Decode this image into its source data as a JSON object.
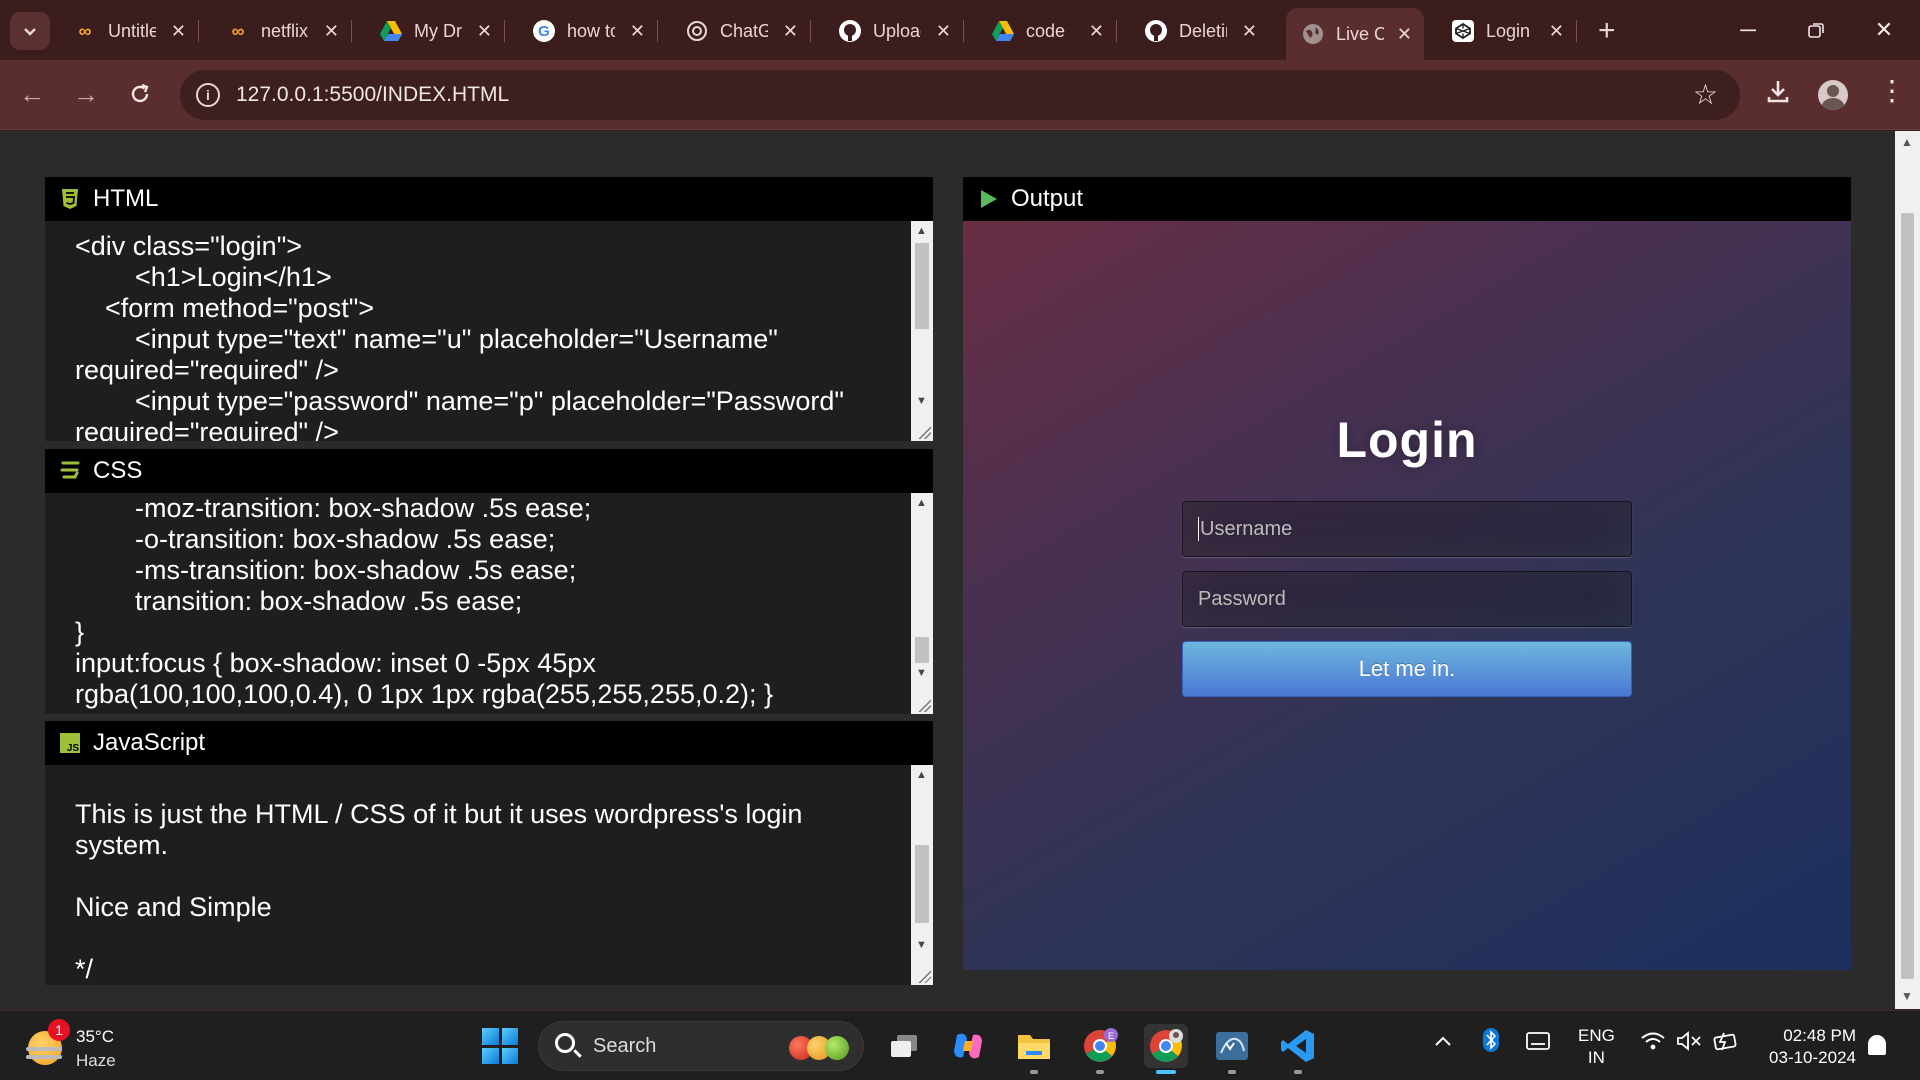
{
  "browser": {
    "tabs": [
      {
        "icon": "codepen-infinity-icon",
        "title": "Untitled",
        "active": false
      },
      {
        "icon": "codepen-infinity-icon",
        "title": "netflix",
        "active": false
      },
      {
        "icon": "google-drive-icon",
        "title": "My Drive",
        "active": false
      },
      {
        "icon": "google-icon",
        "title": "how to",
        "active": false
      },
      {
        "icon": "chatgpt-icon",
        "title": "ChatGPT",
        "active": false
      },
      {
        "icon": "github-icon",
        "title": "Upload",
        "active": false
      },
      {
        "icon": "google-drive-icon",
        "title": "code",
        "active": false
      },
      {
        "icon": "github-icon",
        "title": "Deleting",
        "active": false
      },
      {
        "icon": "globe-icon",
        "title": "Live Code",
        "active": true
      },
      {
        "icon": "codepen-box-icon",
        "title": "Login",
        "active": false
      }
    ],
    "url": "127.0.0.1:5500/INDEX.HTML"
  },
  "panels": {
    "html": {
      "title": "HTML",
      "code": "<div class=\"login\">\n        <h1>Login</h1>\n    <form method=\"post\">\n        <input type=\"text\" name=\"u\" placeholder=\"Username\"\nrequired=\"required\" />\n        <input type=\"password\" name=\"p\" placeholder=\"Password\"\nrequired=\"required\" />"
    },
    "css": {
      "title": "CSS",
      "lines": [
        {
          "text": "        -moz-transition: box-shadow .5s ease;"
        },
        {
          "text": "        -o-transition: box-shadow .5s ease;"
        },
        {
          "text": "        -ms-transition: box-shadow .5s ease;"
        },
        {
          "text": "        transition: box-shadow .5s ease;"
        },
        {
          "text": "}"
        },
        {
          "text": "input:focus { box-shadow: inset 0 -5px 45px"
        },
        {
          "text": "rgba(100,100,100,0.4), 0 1px 1px rgba(255,255,255,0.2); }"
        }
      ]
    },
    "js": {
      "title": "JavaScript",
      "line1": "This is just the HTML / CSS of it but it uses wordpress's login",
      "line2": "system.",
      "line3": "Nice and Simple",
      "line4": "*/"
    },
    "output": {
      "title": "Output",
      "login_heading": "Login",
      "username_placeholder": "Username",
      "password_placeholder": "Password",
      "submit_label": "Let me in."
    }
  },
  "taskbar": {
    "weather_temp": "35°C",
    "weather_condition": "Haze",
    "weather_badge": "1",
    "search_label": "Search",
    "language": "ENG",
    "region": "IN",
    "time": "02:48 PM",
    "date": "03-10-2024"
  },
  "colors": {
    "accent_button": "#4a77d4",
    "tab_bar": "#3b1d1d",
    "toolbar": "#5a2e2e"
  }
}
